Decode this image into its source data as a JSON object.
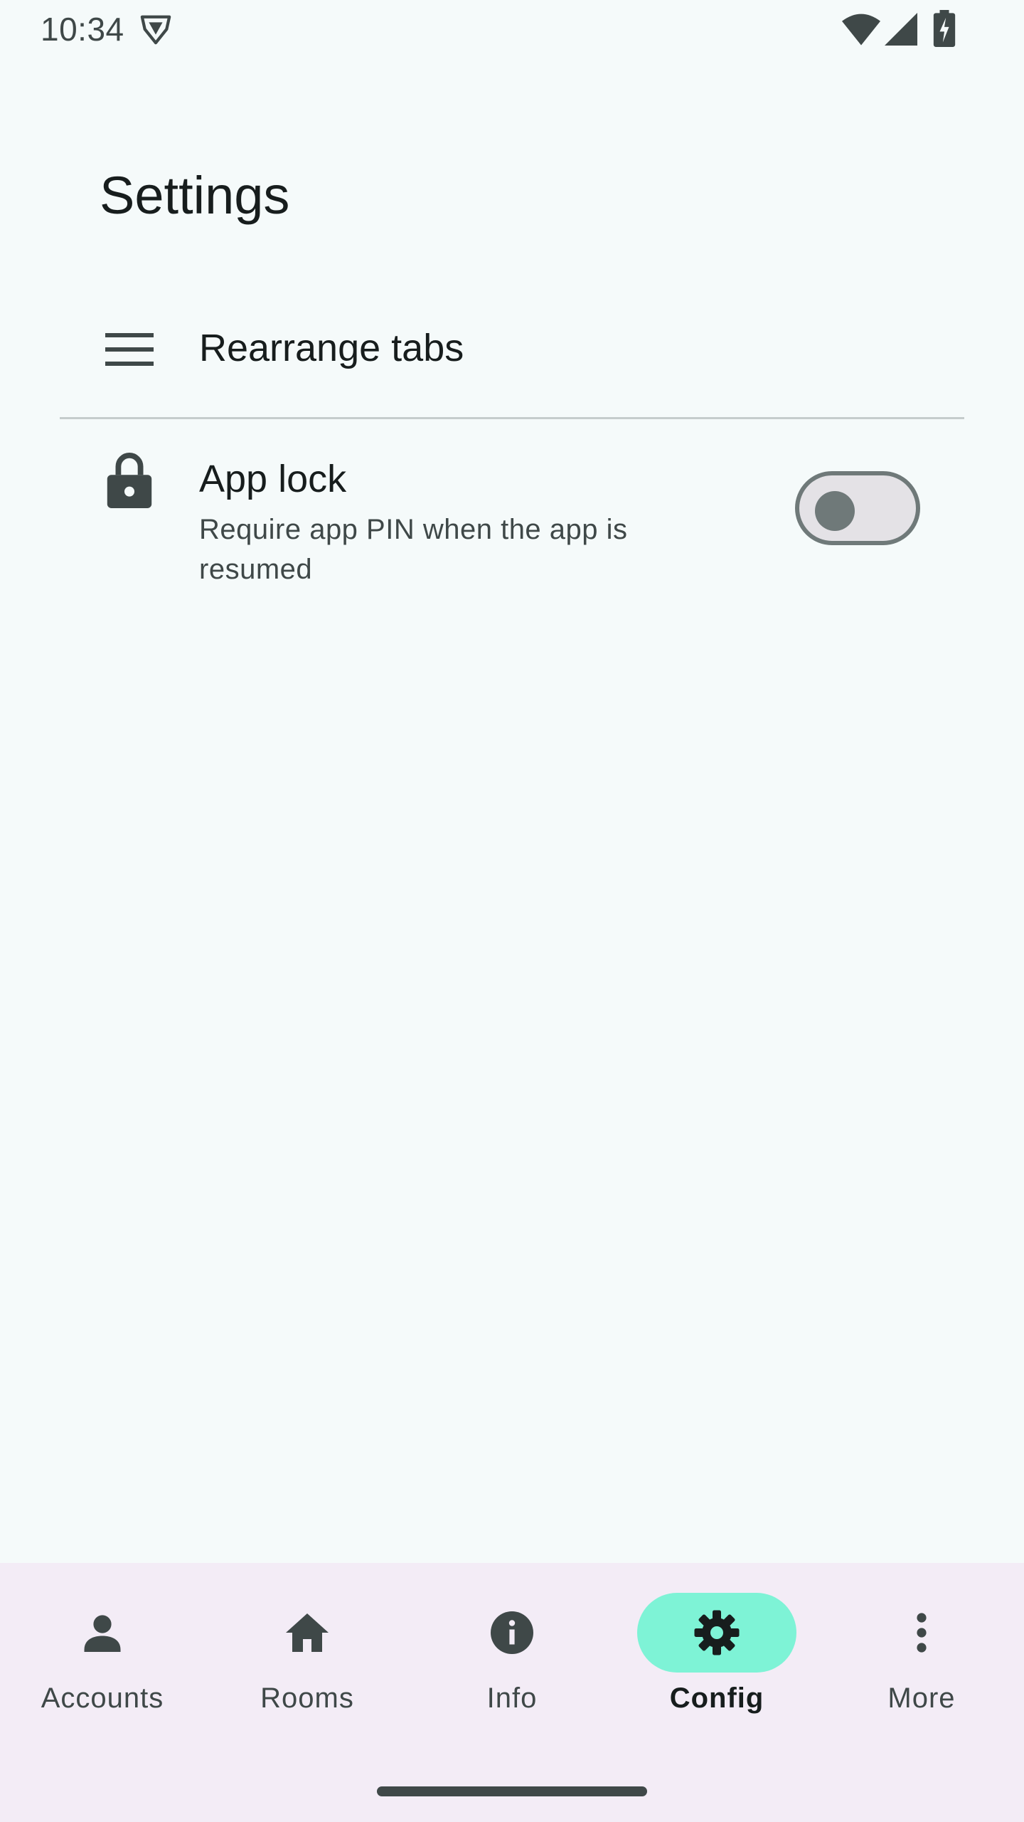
{
  "status_bar": {
    "time": "10:34"
  },
  "page": {
    "title": "Settings"
  },
  "settings": {
    "rearrange_tabs": {
      "title": "Rearrange tabs",
      "icon": "menu-icon"
    },
    "app_lock": {
      "title": "App lock",
      "subtitle": "Require app PIN when the app is resumed",
      "icon": "lock-icon",
      "enabled": false
    }
  },
  "bottom_nav": {
    "items": [
      {
        "label": "Accounts",
        "icon": "person-icon",
        "active": false
      },
      {
        "label": "Rooms",
        "icon": "home-icon",
        "active": false
      },
      {
        "label": "Info",
        "icon": "info-icon",
        "active": false
      },
      {
        "label": "Config",
        "icon": "gear-icon",
        "active": true
      },
      {
        "label": "More",
        "icon": "more-vert-icon",
        "active": false
      }
    ]
  },
  "colors": {
    "background": "#f5fafa",
    "nav_background": "#f3ecf6",
    "active_pill": "#7ef3d6",
    "icon": "#3f4848",
    "text": "#171d1d"
  }
}
